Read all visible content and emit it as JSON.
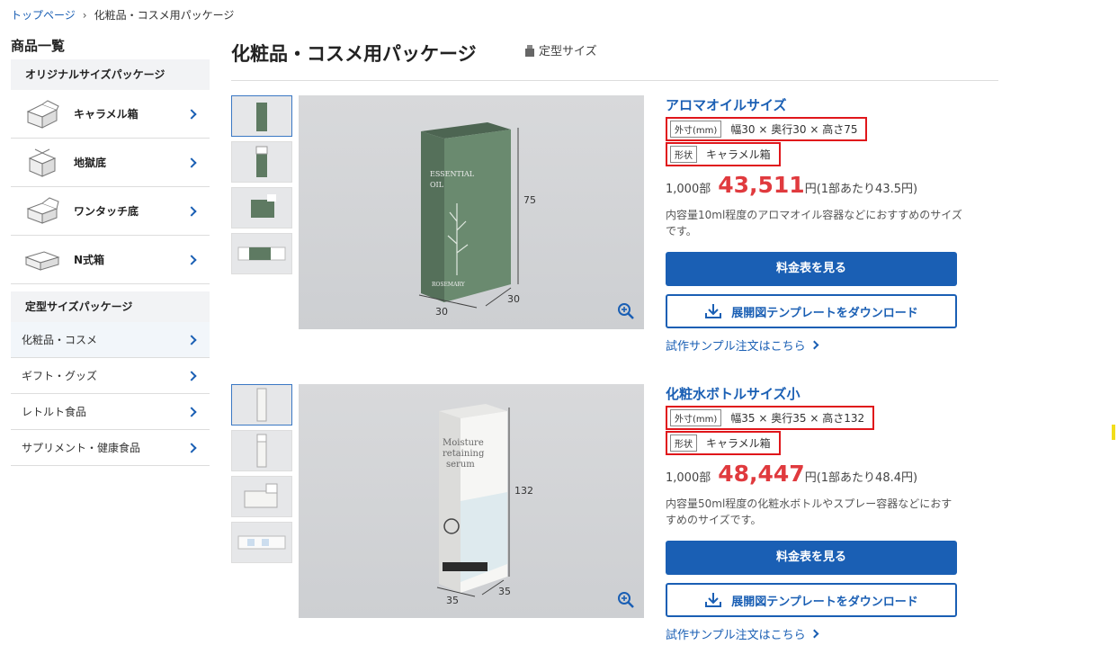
{
  "breadcrumb": {
    "home": "トップページ",
    "separator": "›",
    "current": "化粧品・コスメ用パッケージ"
  },
  "sidebar": {
    "title": "商品一覧",
    "original_heading": "オリジナルサイズパッケージ",
    "original_items": [
      {
        "label": "キャラメル箱",
        "icon": "caramel-box-icon"
      },
      {
        "label": "地獄底",
        "icon": "hell-bottom-box-icon"
      },
      {
        "label": "ワンタッチ底",
        "icon": "one-touch-box-icon"
      },
      {
        "label": "N式箱",
        "icon": "n-type-box-icon"
      }
    ],
    "standard_heading": "定型サイズパッケージ",
    "standard_items": [
      {
        "label": "化粧品・コスメ"
      },
      {
        "label": "ギフト・グッズ"
      },
      {
        "label": "レトルト食品"
      },
      {
        "label": "サプリメント・健康食品"
      }
    ]
  },
  "page": {
    "title": "化粧品・コスメ用パッケージ",
    "tag": "定型サイズ"
  },
  "products": [
    {
      "name": "アロマオイルサイズ",
      "dim_label": "外寸(mm)",
      "dim_value": "幅30 × 奥行30 × 高さ75",
      "shape_label": "形状",
      "shape_value": "キャラメル箱",
      "qty": "1,000部",
      "price": "43,511",
      "price_suffix": "円(1部あたり43.5円)",
      "description": "内容量10ml程度のアロマオイル容器などにおすすめのサイズです。",
      "btn_price": "料金表を見る",
      "btn_download": "展開図テンプレートをダウンロード",
      "link_sample": "試作サンプル注文はこちら",
      "dims": {
        "height": "75",
        "width": "30",
        "depth": "30"
      },
      "box": {
        "color": "#5e7a62",
        "text1": "ESSENTIAL",
        "text2": "OIL",
        "text3": "ROSEMARY"
      }
    },
    {
      "name": "化粧水ボトルサイズ小",
      "dim_label": "外寸(mm)",
      "dim_value": "幅35 × 奥行35 × 高さ132",
      "shape_label": "形状",
      "shape_value": "キャラメル箱",
      "qty": "1,000部",
      "price": "48,447",
      "price_suffix": "円(1部あたり48.4円)",
      "description": "内容量50ml程度の化粧水ボトルやスプレー容器などにおすすめのサイズです。",
      "btn_price": "料金表を見る",
      "btn_download": "展開図テンプレートをダウンロード",
      "link_sample": "試作サンプル注文はこちら",
      "dims": {
        "height": "132",
        "width": "35",
        "depth": "35"
      },
      "box": {
        "color": "#f4f4f2",
        "text1": "Moisture",
        "text2": "retaining",
        "text3": "serum"
      }
    }
  ]
}
